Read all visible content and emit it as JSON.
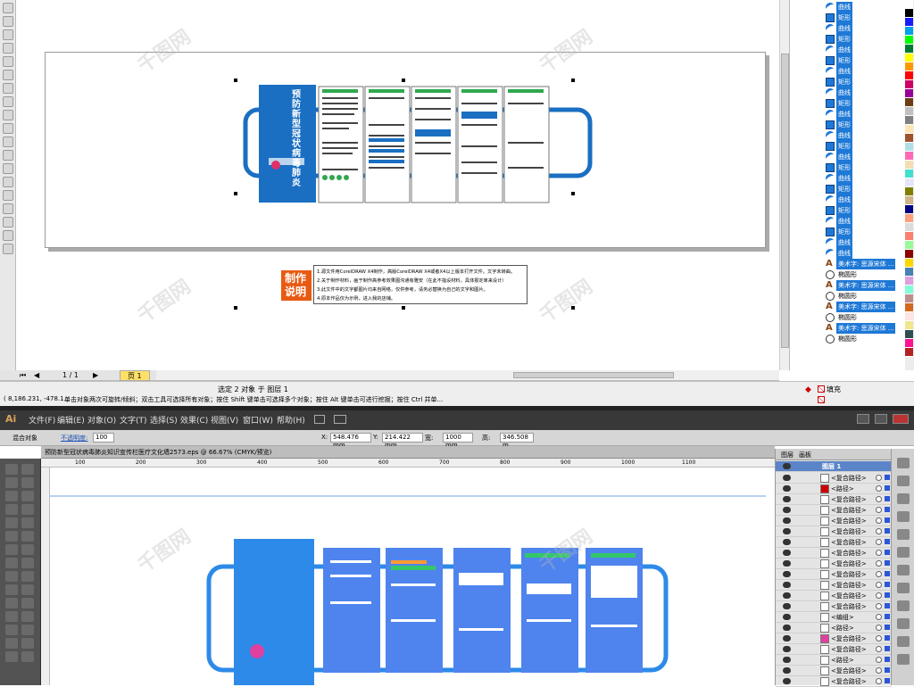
{
  "coreldraw": {
    "objects_manager": {
      "items": [
        {
          "icon": "curve-icon",
          "label": "曲线",
          "selected": true
        },
        {
          "icon": "rect-icon",
          "label": "矩形",
          "selected": true
        },
        {
          "icon": "curve-icon",
          "label": "曲线",
          "selected": true
        },
        {
          "icon": "rect-icon",
          "label": "矩形",
          "selected": true
        },
        {
          "icon": "curve-icon",
          "label": "曲线",
          "selected": true
        },
        {
          "icon": "rect-icon",
          "label": "矩形",
          "selected": true
        },
        {
          "icon": "curve-icon",
          "label": "曲线",
          "selected": true
        },
        {
          "icon": "rect-icon",
          "label": "矩形",
          "selected": true
        },
        {
          "icon": "curve-icon",
          "label": "曲线",
          "selected": true
        },
        {
          "icon": "rect-icon",
          "label": "矩形",
          "selected": true
        },
        {
          "icon": "curve-icon",
          "label": "曲线",
          "selected": true
        },
        {
          "icon": "rect-icon",
          "label": "矩形",
          "selected": true
        },
        {
          "icon": "curve-icon",
          "label": "曲线",
          "selected": true
        },
        {
          "icon": "rect-icon",
          "label": "矩形",
          "selected": true
        },
        {
          "icon": "curve-icon",
          "label": "曲线",
          "selected": true
        },
        {
          "icon": "rect-icon",
          "label": "矩形",
          "selected": true
        },
        {
          "icon": "curve-icon",
          "label": "曲线",
          "selected": true
        },
        {
          "icon": "rect-icon",
          "label": "矩形",
          "selected": true
        },
        {
          "icon": "curve-icon",
          "label": "曲线",
          "selected": true
        },
        {
          "icon": "rect-icon",
          "label": "矩形",
          "selected": true
        },
        {
          "icon": "curve-icon",
          "label": "曲线",
          "selected": true
        },
        {
          "icon": "rect-icon",
          "label": "矩形",
          "selected": true
        },
        {
          "icon": "curve-icon",
          "label": "曲线",
          "selected": true
        },
        {
          "icon": "curve-icon",
          "label": "曲线",
          "selected": true
        },
        {
          "icon": "text-icon",
          "label": "美术字: 思源宋体 ...",
          "selected": true
        },
        {
          "icon": "ellipse-icon",
          "label": "椭圆形",
          "selected": false
        },
        {
          "icon": "text-icon",
          "label": "美术字: 思源宋体 ...",
          "selected": true
        },
        {
          "icon": "ellipse-icon",
          "label": "椭圆形",
          "selected": false
        },
        {
          "icon": "text-icon",
          "label": "美术字: 思源宋体 ...",
          "selected": true
        },
        {
          "icon": "ellipse-icon",
          "label": "椭圆形",
          "selected": false
        },
        {
          "icon": "text-icon",
          "label": "美术字: 思源宋体 ...",
          "selected": true
        },
        {
          "icon": "ellipse-icon",
          "label": "椭圆形",
          "selected": false
        }
      ]
    },
    "page_nav": {
      "position": "1 / 1",
      "page_tab": "页 1"
    },
    "status": {
      "selection": "选定 2 对象 于 图层 1",
      "coords": "( 8,186.231, -478.1...",
      "hint": "单击对象两次可旋转/倾斜；双击工具可选择所有对象；按住 Shift 键单击可选择多个对象；按住 Alt 键单击可进行挖掘；按住 Ctrl 并单...",
      "fill_label": "填充"
    },
    "design": {
      "title": "预防新型冠状病毒肺炎",
      "note_title": "制作说明",
      "notes": [
        "1.源文件用CorelDRAW X4制作，高版CorelDRAW X4或者X4以上版本打开文件。文字未转曲。",
        "2.关于制作材料，画于制作高参考效果图沟通有雅安（在此不指设材料，具体报定单来设计）",
        "3.此文件中的文字都图片均来自网络，仅供参考，请务必替换为自己的文字和图片。",
        "4.原本作品仅为示例，进入我的店铺。"
      ]
    },
    "palette": [
      "#ffffff",
      "#000000",
      "#1b1bff",
      "#00a0e9",
      "#00ff00",
      "#007a33",
      "#ffff00",
      "#ff9900",
      "#ff0000",
      "#cc0066",
      "#990099",
      "#6a3e12",
      "#c0c0c0",
      "#808080",
      "#ffe4b5",
      "#a0522d",
      "#b0e0e6",
      "#ff69b4",
      "#f5deb3",
      "#40e0d0",
      "#e6e6fa",
      "#808000",
      "#d2b48c",
      "#000080",
      "#ffa07a",
      "#dcdcdc",
      "#fa8072",
      "#98fb98",
      "#8b0000",
      "#ffd700",
      "#4682b4",
      "#dda0dd",
      "#7fffd4",
      "#bc8f8f",
      "#d2691e",
      "#ffe4e1",
      "#f0e68c",
      "#2f4f4f",
      "#ff1493",
      "#b22222"
    ]
  },
  "illustrator": {
    "logo": "Ai",
    "menus": [
      "文件(F)",
      "编辑(E)",
      "对象(O)",
      "文字(T)",
      "选择(S)",
      "效果(C)",
      "视图(V)",
      "窗口(W)",
      "帮助(H)"
    ],
    "control": {
      "mode_label": "混合对象",
      "opacity_label": "不透明度:",
      "opacity_value": "100",
      "x_label": "X:",
      "x_value": "548.476 mm",
      "y_label": "Y:",
      "y_value": "214.422 mm",
      "w_label": "宽:",
      "w_value": "1000 mm",
      "h_label": "高:",
      "h_value": "346.508 m"
    },
    "doc_tab": "预防新型冠状病毒肺炎知识宣传栏医疗文化墙2573.eps @ 66.67% (CMYK/预览)",
    "ruler_ticks": [
      "100",
      "200",
      "300",
      "400",
      "500",
      "600",
      "700",
      "800",
      "900",
      "1000",
      "1100"
    ],
    "layers_panel": {
      "tabs": [
        "图层",
        "画板"
      ],
      "layer_name": "图层 1",
      "rows": [
        "<复合路径>",
        "<路径>",
        "<复合路径>",
        "<复合路径>",
        "<复合路径>",
        "<复合路径>",
        "<复合路径>",
        "<复合路径>",
        "<复合路径>",
        "<复合路径>",
        "<复合路径>",
        "<复合路径>",
        "<复合路径>",
        "<编组>",
        "<路径>",
        "<复合路径>",
        "<复合路径>",
        "<路径>",
        "<复合路径>",
        "<复合路径>"
      ],
      "thumb_colors": [
        "#fff",
        "#d00000",
        "#fff",
        "#fff",
        "#fff",
        "#fff",
        "#fff",
        "#fff",
        "#fff",
        "#fff",
        "#fff",
        "#fff",
        "#fff",
        "#fff",
        "#fff",
        "#e040a0",
        "#fff",
        "#fff",
        "#fff",
        "#fff"
      ]
    }
  }
}
